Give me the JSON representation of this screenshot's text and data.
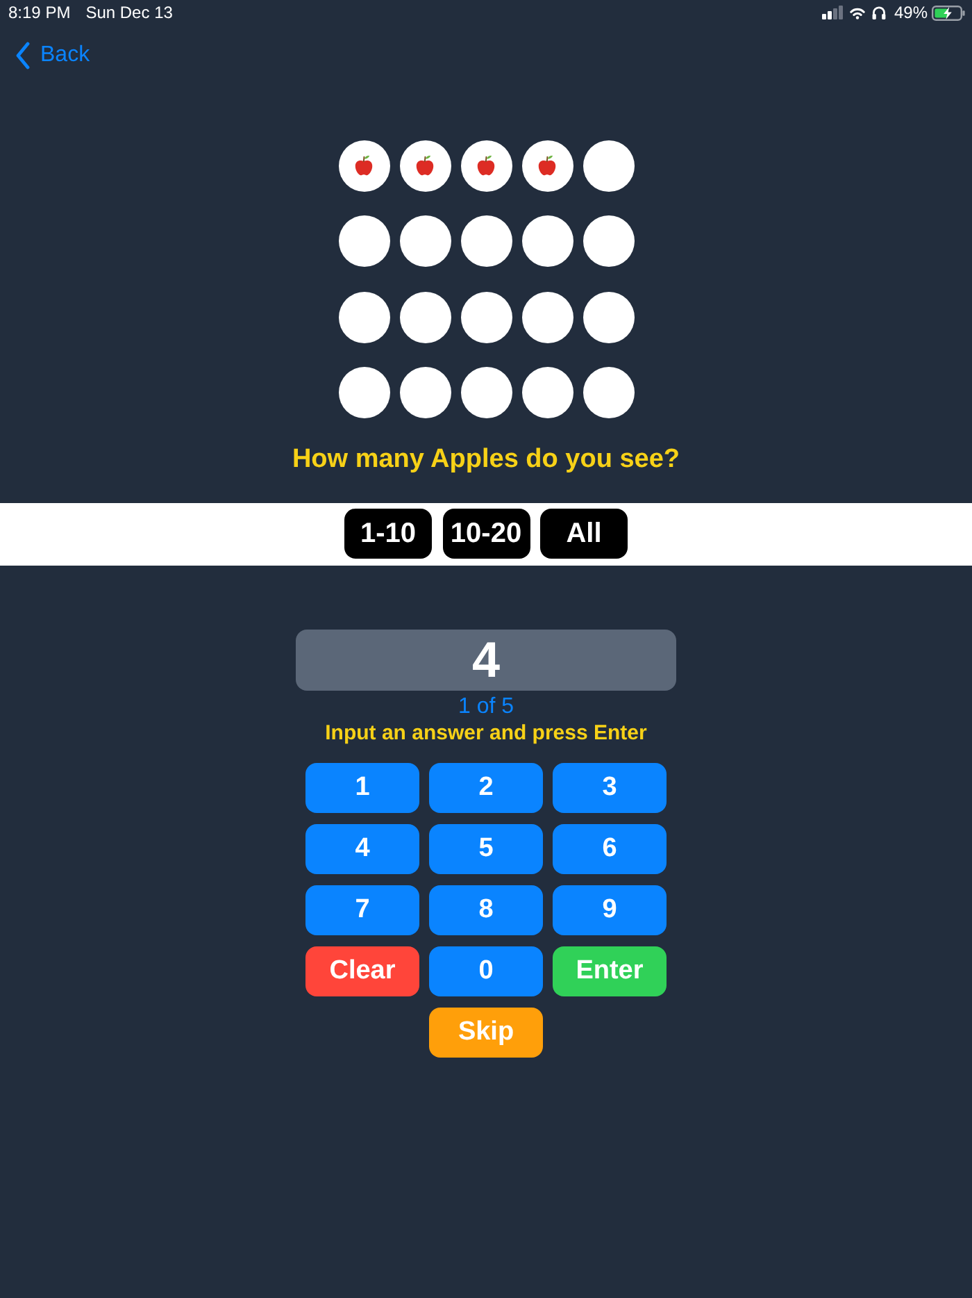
{
  "status_bar": {
    "time": "8:19 PM",
    "date": "Sun Dec 13",
    "battery": "49%"
  },
  "nav": {
    "back": "Back"
  },
  "grid": {
    "cells": [
      {
        "apple": true
      },
      {
        "apple": true
      },
      {
        "apple": true
      },
      {
        "apple": true
      },
      {
        "apple": false
      },
      {
        "apple": false
      },
      {
        "apple": false
      },
      {
        "apple": false
      },
      {
        "apple": false
      },
      {
        "apple": false
      },
      {
        "apple": false
      },
      {
        "apple": false
      },
      {
        "apple": false
      },
      {
        "apple": false
      },
      {
        "apple": false
      },
      {
        "apple": false
      },
      {
        "apple": false
      },
      {
        "apple": false
      },
      {
        "apple": false
      },
      {
        "apple": false
      }
    ]
  },
  "question": "How many Apples do you see?",
  "ranges": [
    {
      "label": "1-10"
    },
    {
      "label": "10-20"
    },
    {
      "label": "All"
    }
  ],
  "answer": {
    "value": "4"
  },
  "progress": "1 of 5",
  "instruction": "Input an answer and press Enter",
  "keypad": [
    {
      "label": "1",
      "kind": "digit"
    },
    {
      "label": "2",
      "kind": "digit"
    },
    {
      "label": "3",
      "kind": "digit"
    },
    {
      "label": "4",
      "kind": "digit"
    },
    {
      "label": "5",
      "kind": "digit"
    },
    {
      "label": "6",
      "kind": "digit"
    },
    {
      "label": "7",
      "kind": "digit"
    },
    {
      "label": "8",
      "kind": "digit"
    },
    {
      "label": "9",
      "kind": "digit"
    },
    {
      "label": "Clear",
      "kind": "clear"
    },
    {
      "label": "0",
      "kind": "digit"
    },
    {
      "label": "Enter",
      "kind": "enter"
    },
    {
      "label": "Skip",
      "kind": "skip"
    }
  ]
}
